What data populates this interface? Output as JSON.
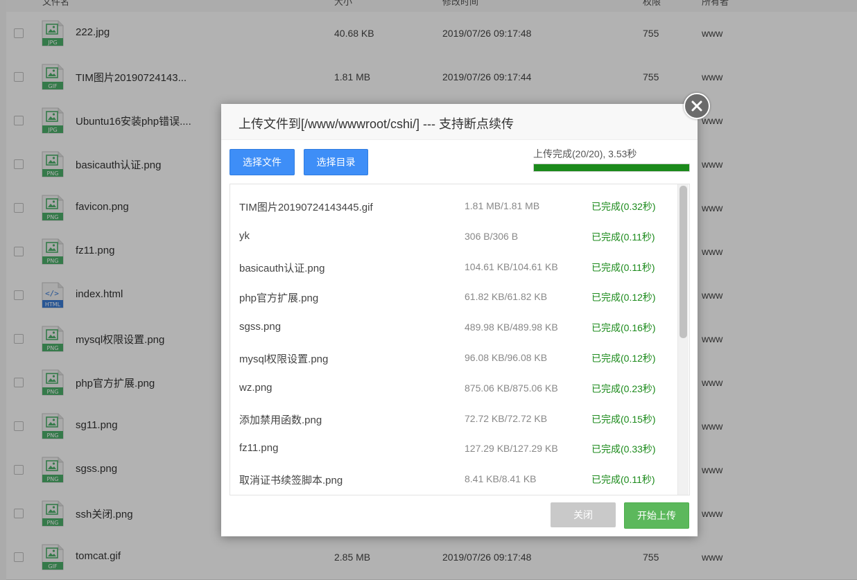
{
  "table": {
    "header": [
      "文件名",
      "大小",
      "修改时间",
      "权限",
      "所有者"
    ],
    "rows": [
      {
        "name": "222.jpg",
        "type": "JPG",
        "size": "40.68 KB",
        "date": "2019/07/26 09:17:48",
        "perm": "755",
        "owner": "www"
      },
      {
        "name": "TIM图片20190724143...",
        "type": "GIF",
        "size": "1.81 MB",
        "date": "2019/07/26 09:17:44",
        "perm": "755",
        "owner": "www"
      },
      {
        "name": "Ubuntu16安装php错误....",
        "type": "JPG",
        "size": "",
        "date": "",
        "perm": "",
        "owner": "www"
      },
      {
        "name": "basicauth认证.png",
        "type": "PNG",
        "size": "",
        "date": "",
        "perm": "",
        "owner": "www"
      },
      {
        "name": "favicon.png",
        "type": "PNG",
        "size": "",
        "date": "",
        "perm": "",
        "owner": "www"
      },
      {
        "name": "fz11.png",
        "type": "PNG",
        "size": "",
        "date": "",
        "perm": "",
        "owner": "www"
      },
      {
        "name": "index.html",
        "type": "HTML",
        "size": "",
        "date": "",
        "perm": "",
        "owner": "www"
      },
      {
        "name": "mysql权限设置.png",
        "type": "PNG",
        "size": "",
        "date": "",
        "perm": "",
        "owner": "www"
      },
      {
        "name": "php官方扩展.png",
        "type": "PNG",
        "size": "",
        "date": "",
        "perm": "",
        "owner": "www"
      },
      {
        "name": "sg11.png",
        "type": "PNG",
        "size": "",
        "date": "",
        "perm": "",
        "owner": "www"
      },
      {
        "name": "sgss.png",
        "type": "PNG",
        "size": "",
        "date": "",
        "perm": "",
        "owner": "www"
      },
      {
        "name": "ssh关闭.png",
        "type": "PNG",
        "size": "",
        "date": "",
        "perm": "",
        "owner": "www"
      },
      {
        "name": "tomcat.gif",
        "type": "GIF",
        "size": "2.85 MB",
        "date": "2019/07/26 09:17:48",
        "perm": "755",
        "owner": "www"
      }
    ]
  },
  "modal": {
    "title": "上传文件到[/www/wwwroot/cshi/] --- 支持断点续传",
    "select_file_label": "选择文件",
    "select_dir_label": "选择目录",
    "progress_text": "上传完成(20/20), 3.53秒",
    "progress_fraction": 1.0,
    "close_label": "关闭",
    "start_label": "开始上传",
    "files": [
      {
        "name": "TIM图片20190724143445.gif",
        "size": "1.81 MB/1.81 MB",
        "status": "已完成(0.32秒)"
      },
      {
        "name": "yk",
        "size": "306 B/306 B",
        "status": "已完成(0.11秒)"
      },
      {
        "name": "basicauth认证.png",
        "size": "104.61 KB/104.61 KB",
        "status": "已完成(0.11秒)"
      },
      {
        "name": "php官方扩展.png",
        "size": "61.82 KB/61.82 KB",
        "status": "已完成(0.12秒)"
      },
      {
        "name": "sgss.png",
        "size": "489.98 KB/489.98 KB",
        "status": "已完成(0.16秒)"
      },
      {
        "name": "mysql权限设置.png",
        "size": "96.08 KB/96.08 KB",
        "status": "已完成(0.12秒)"
      },
      {
        "name": "wz.png",
        "size": "875.06 KB/875.06 KB",
        "status": "已完成(0.23秒)"
      },
      {
        "name": "添加禁用函数.png",
        "size": "72.72 KB/72.72 KB",
        "status": "已完成(0.15秒)"
      },
      {
        "name": "fz11.png",
        "size": "127.29 KB/127.29 KB",
        "status": "已完成(0.33秒)"
      },
      {
        "name": "取消证书续签脚本.png",
        "size": "8.41 KB/8.41 KB",
        "status": "已完成(0.11秒)"
      }
    ]
  },
  "colors": {
    "icon_green": "#4caf6a",
    "icon_blue": "#3a7bd5",
    "progress_green": "#1b8a1b",
    "button_blue": "#3e8ef7",
    "button_green": "#5cb85c"
  }
}
